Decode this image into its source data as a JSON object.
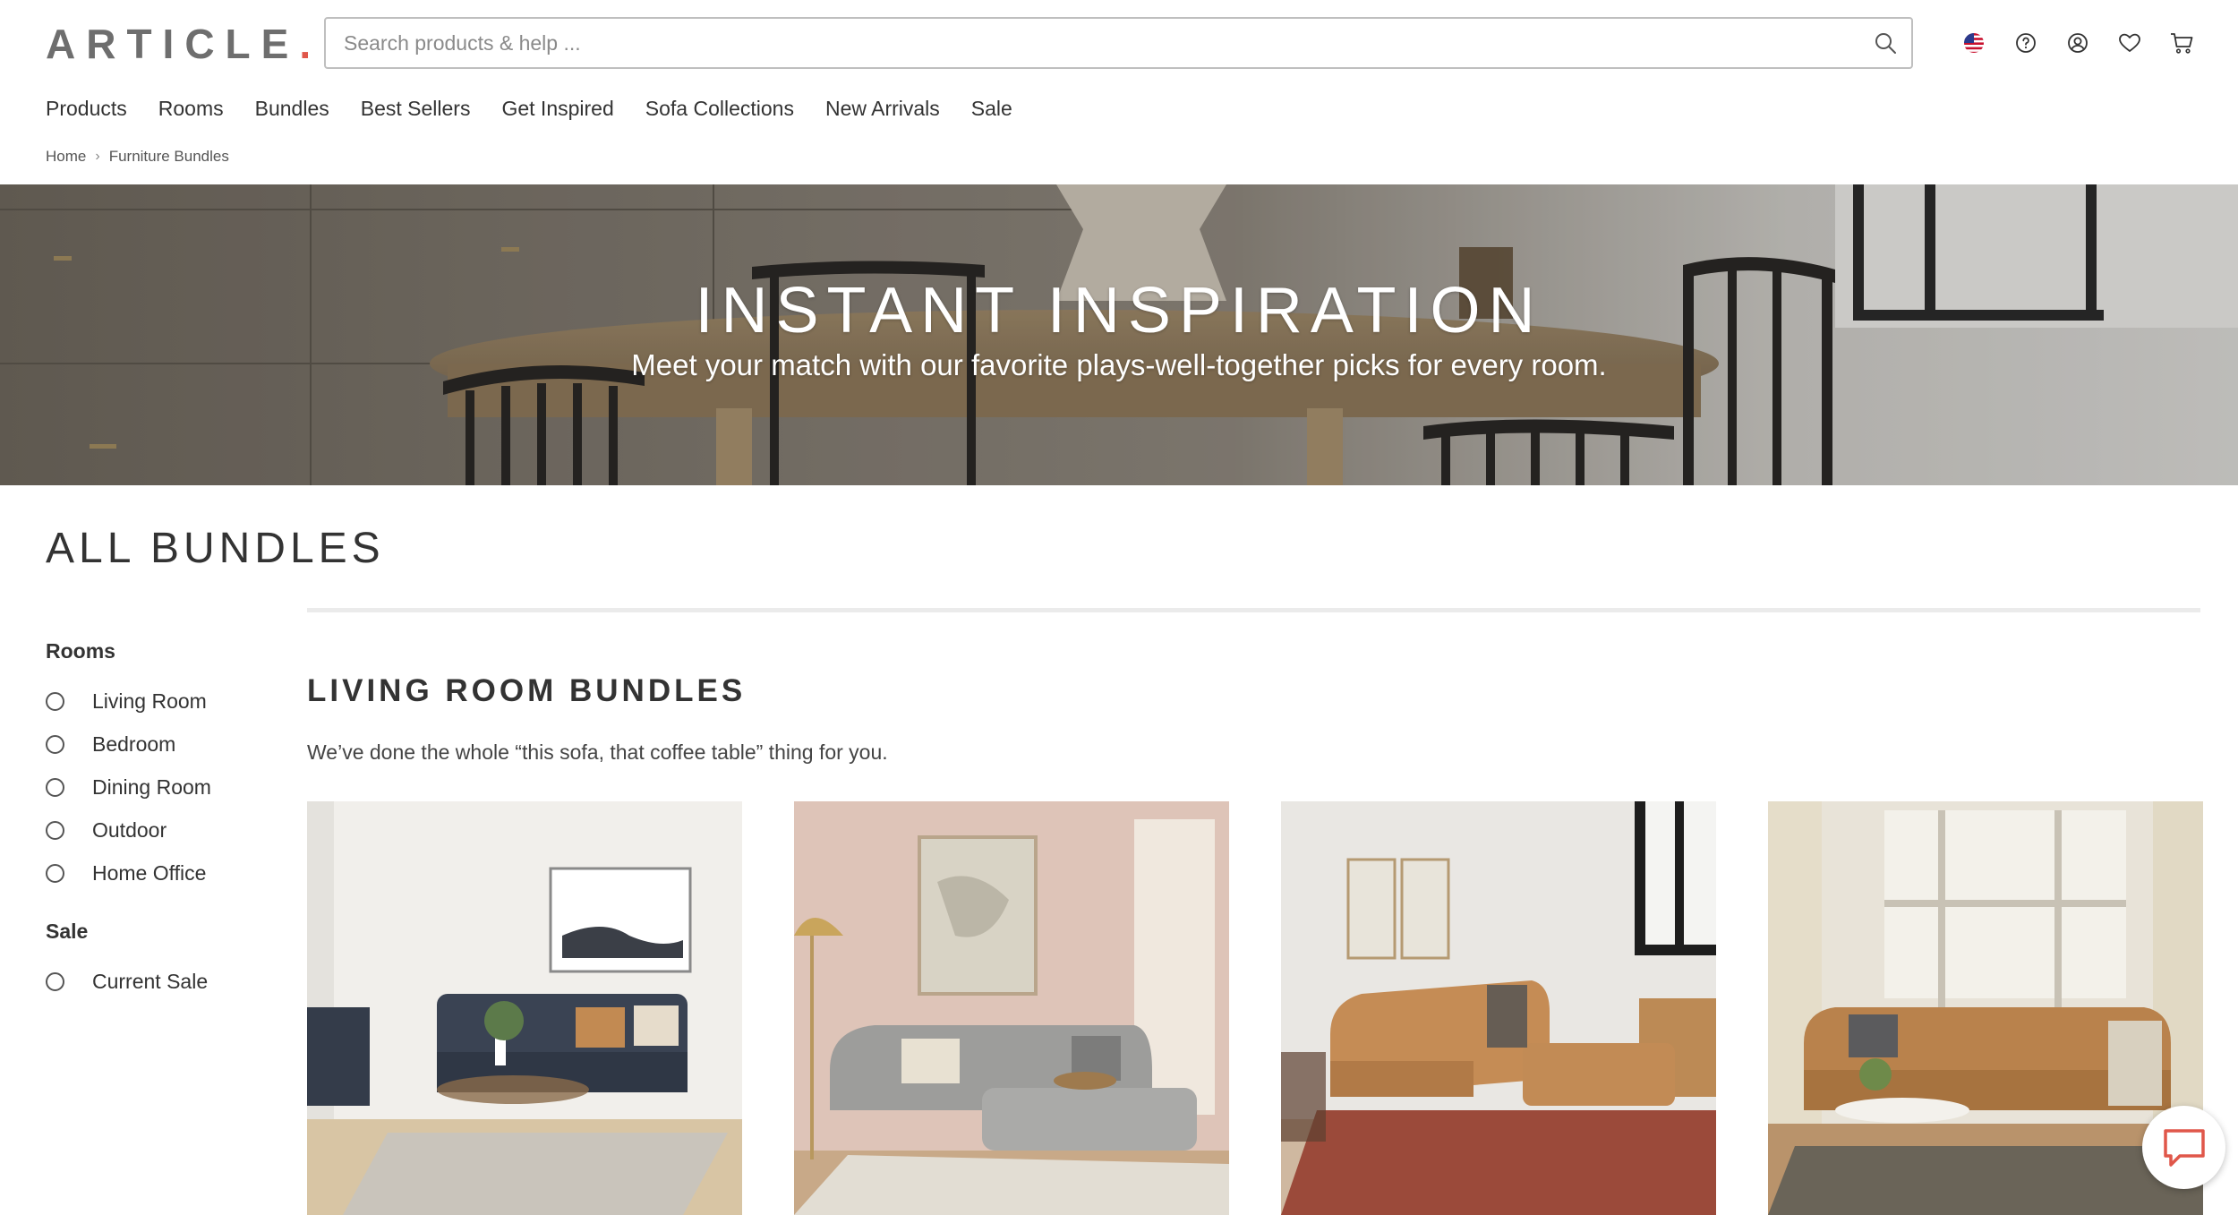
{
  "brand": {
    "logo_text": "ARTICLE",
    "logo_dot": ".",
    "accent_color": "#e0574a"
  },
  "search": {
    "placeholder": "Search products & help ...",
    "value": ""
  },
  "header_icons": [
    "us-flag-icon",
    "help-icon",
    "account-icon",
    "heart-icon",
    "cart-icon"
  ],
  "nav": {
    "items": [
      "Products",
      "Rooms",
      "Bundles",
      "Best Sellers",
      "Get Inspired",
      "Sofa Collections",
      "New Arrivals",
      "Sale"
    ]
  },
  "breadcrumb": {
    "items": [
      "Home",
      "Furniture Bundles"
    ]
  },
  "hero": {
    "title": "INSTANT INSPIRATION",
    "subtitle": "Meet your match with our favorite plays-well-together picks for every room."
  },
  "page": {
    "heading": "ALL BUNDLES"
  },
  "filters": {
    "rooms": {
      "heading": "Rooms",
      "options": [
        "Living Room",
        "Bedroom",
        "Dining Room",
        "Outdoor",
        "Home Office"
      ]
    },
    "sale": {
      "heading": "Sale",
      "options": [
        "Current Sale"
      ]
    }
  },
  "section": {
    "title": "LIVING ROOM BUNDLES",
    "description": "We’ve done the whole “this sofa, that coffee table” thing for you."
  }
}
